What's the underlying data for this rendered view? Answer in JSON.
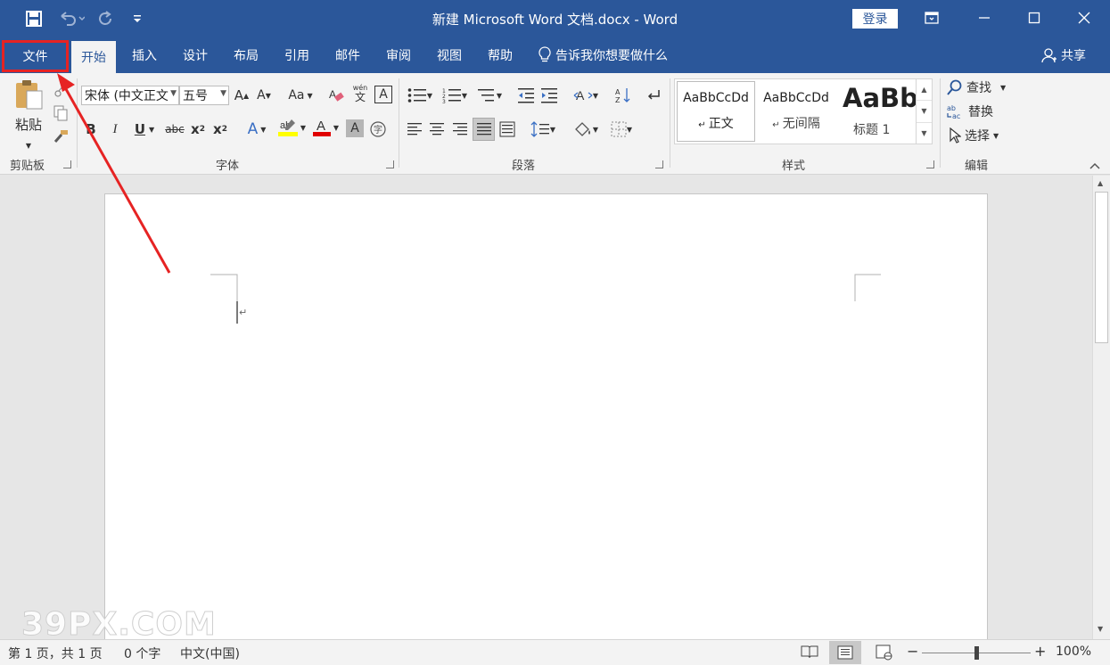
{
  "window": {
    "title": "新建 Microsoft Word 文档.docx  -  Word",
    "login_label": "登录"
  },
  "quick_access": {
    "icons": [
      "save-icon",
      "undo-icon",
      "redo-icon",
      "customize-icon"
    ]
  },
  "tabs": [
    {
      "label": "文件",
      "state": "highlighted"
    },
    {
      "label": "开始",
      "state": "active"
    },
    {
      "label": "插入"
    },
    {
      "label": "设计"
    },
    {
      "label": "布局"
    },
    {
      "label": "引用"
    },
    {
      "label": "邮件"
    },
    {
      "label": "审阅"
    },
    {
      "label": "视图"
    },
    {
      "label": "帮助"
    }
  ],
  "tell_me": "告诉我你想要做什么",
  "share_label": "共享",
  "ribbon": {
    "clipboard": {
      "paste_label": "粘贴",
      "group_label": "剪贴板"
    },
    "font": {
      "font_name": "宋体 (中文正文",
      "font_size": "五号",
      "change_case": "Aa",
      "phonetic": "wén",
      "group_label": "字体",
      "highlight_color": "#ffff00",
      "font_color": "#e00000"
    },
    "paragraph": {
      "group_label": "段落"
    },
    "styles": {
      "items": [
        {
          "preview": "AaBbCcDd",
          "name": "正文"
        },
        {
          "preview": "AaBbCcDd",
          "name": "无间隔"
        },
        {
          "preview": "AaBb",
          "name": "标题 1"
        }
      ],
      "group_label": "样式"
    },
    "editing": {
      "find_label": "查找",
      "replace_label": "替换",
      "select_label": "选择",
      "group_label": "编辑"
    }
  },
  "status": {
    "page_info": "第 1 页，共 1 页",
    "word_count": "0 个字",
    "language": "中文(中国)",
    "zoom": "100%",
    "zoom_minus": "−",
    "zoom_plus": "+"
  },
  "watermark": "39PX.COM",
  "colors": {
    "brand": "#2b579a",
    "annotation": "#e62323"
  }
}
